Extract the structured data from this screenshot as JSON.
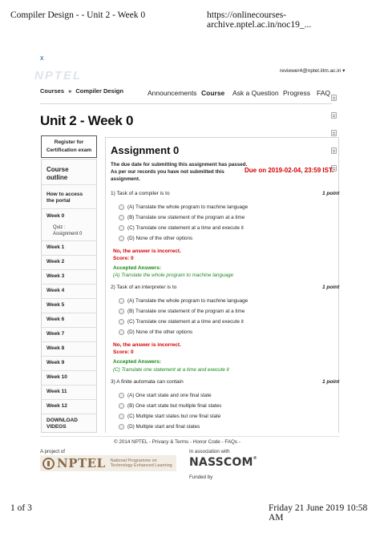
{
  "print": {
    "title": "Compiler Design - - Unit 2 - Week 0",
    "url": "https://onlinecourses-archive.nptel.ac.in/noc19_...",
    "page": "1 of 3",
    "datetime": "Friday 21 June 2019 10:58 AM"
  },
  "header": {
    "close_glyph": "x",
    "logo_text": "NPTEL",
    "user_email": "reviewer4@nptel.iitm.ac.in",
    "user_caret": "▾"
  },
  "breadcrumb": {
    "courses": "Courses",
    "sep": "»",
    "course": "Compiler Design"
  },
  "nav": {
    "announcements": "Announcements",
    "course": "Course",
    "ask": "Ask a Question",
    "progress": "Progress",
    "faq": "FAQ"
  },
  "unit_title": "Unit 2 - Week 0",
  "sidebar": {
    "register_line1": "Register for",
    "register_line2": "Certification exam",
    "outline_line1": "Course",
    "outline_line2": "outline",
    "items": [
      {
        "l1": "How to access",
        "l2": "the portal"
      },
      {
        "l1": "Week 0"
      },
      {
        "l1": "Week 1"
      },
      {
        "l1": "Week 2"
      },
      {
        "l1": "Week 3"
      },
      {
        "l1": "Week 4"
      },
      {
        "l1": "Week 5"
      },
      {
        "l1": "Week 6"
      },
      {
        "l1": "Week 7"
      },
      {
        "l1": "Week 8"
      },
      {
        "l1": "Week 9"
      },
      {
        "l1": "Week 10"
      },
      {
        "l1": "Week 11"
      },
      {
        "l1": "Week 12"
      },
      {
        "l1": "DOWNLOAD",
        "l2": "VIDEOS"
      }
    ],
    "sub_item_l1": "Quiz :",
    "sub_item_l2": "Assignment 0"
  },
  "assignment": {
    "title": "Assignment 0",
    "note_line1": "The due date for submitting this assignment has passed.",
    "note_line2": "As per our records you have not submitted this",
    "note_line3": "assignment.",
    "due": "Due on 2019-02-04, 23:59 IST.",
    "questions": [
      {
        "text": "1) Task of a compiler is to",
        "points": "1 point",
        "options": [
          "(A) Translate the whole program to machine language",
          "(B) Translate one statement of the program at a time",
          "(C) Translate one statement at a time and execute it",
          "(D) None of the other options"
        ],
        "result": "No, the answer is incorrect.",
        "score": "Score: 0",
        "accepted_label": "Accepted Answers:",
        "accepted": "(A) Translate the whole program to machine language"
      },
      {
        "text": "2) Task of an interpreter is to",
        "points": "1 point",
        "options": [
          "(A) Translate the whole program to machine language",
          "(B) Translate one statement of the program at a time",
          "(C) Translate one statement at a time and execute it",
          "(D) None of the other options"
        ],
        "result": "No, the answer is incorrect.",
        "score": "Score: 0",
        "accepted_label": "Accepted Answers:",
        "accepted": "(C) Translate one statement at a time and execute it"
      },
      {
        "text": "3) A finite automata can contain",
        "points": "1 point",
        "options": [
          "(A) One start state and one final state",
          "(B) One start state but multiple final states",
          "(C) Multiple start states but one final state",
          "(D) Multiple start and final states"
        ]
      }
    ]
  },
  "footer": {
    "copyright": "© 2014 NPTEL - Privacy & Terms - Honor Code - FAQs -",
    "project_of": "A project of",
    "in_association": "In association with",
    "funded_by": "Funded by",
    "nptel_word": "NPTEL",
    "nptel_tag1": "National Programme on",
    "nptel_tag2": "Technology Enhanced Learning",
    "nasscom_word": "NASSCOM",
    "nasscom_reg": "®"
  },
  "colors": {
    "incorrect": "#d40000",
    "accepted": "#1a8a1a",
    "nptel_brand": "#8a6a4a"
  }
}
